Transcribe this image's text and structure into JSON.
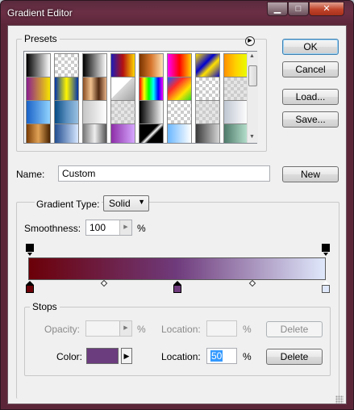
{
  "window": {
    "title": "Gradient Editor"
  },
  "presets": {
    "label": "Presets",
    "menu_icon": "circle-arrow-right-icon",
    "swatches": [
      "linear-gradient(90deg,#000,#fff)",
      "checker-white",
      "linear-gradient(90deg,#000,#fff)",
      "linear-gradient(90deg,#1c1cb8,#b41010,#ffd800)",
      "linear-gradient(90deg,#7a3500,#d8772e,#fde4b6)",
      "linear-gradient(90deg,#ff00ff,#ff0000,#ffd200)",
      "linear-gradient(135deg,#ffe100,#0000d0 40%,#ffe100 60%,#0000d0)",
      "linear-gradient(90deg,#ff9000,#ffd200,#e8ff00)",
      "linear-gradient(90deg,#8b1d8e,#f7e400)",
      "linear-gradient(90deg,#0033aa,#fff600,#0033aa)",
      "linear-gradient(90deg,#8a4d23,#f0c18f,#4f2810,#e9b489)",
      "linear-gradient(135deg,#ffffff 45%,#d8d8d8 45%,#a0a0a0)",
      "linear-gradient(90deg,#f00,#ff0,#0f0,#0ff,#00f,#f0f)",
      "linear-gradient(135deg,#1d59ff,#ff2a2a,#ffe300,#29d829)",
      "checker-white",
      "checker-gray",
      "linear-gradient(90deg,#1a62c7,#91d3ff)",
      "linear-gradient(90deg,#064a83,#5a8fbf,#9bc1e2)",
      "linear-gradient(90deg,#c6c6c6,#ffffff)",
      "checker-gray",
      "linear-gradient(90deg,#000,#ffffff)",
      "checker-white",
      "checker-gray",
      "linear-gradient(90deg,#bfc6d1,#ffffff)",
      "linear-gradient(90deg,#7a3c05,#e0a255,#4a2300)",
      "linear-gradient(90deg,#224e91,#d7e8ff)",
      "linear-gradient(90deg,#777,#eee,#555)",
      "linear-gradient(90deg,#8d2ea7,#d6a7ff)",
      "linear-gradient(135deg,#000 40%,#fff 48%,#000 56%)",
      "linear-gradient(90deg,#6ab7ff,#fff)",
      "linear-gradient(90deg,#3a3a3a,#d5d5d5)",
      "linear-gradient(90deg,#4e7a6a,#b7e1ce)"
    ]
  },
  "buttons": {
    "ok": "OK",
    "cancel": "Cancel",
    "load": "Load...",
    "save": "Save...",
    "new": "New",
    "delete_opacity": "Delete",
    "delete_color": "Delete"
  },
  "name": {
    "label": "Name:",
    "value": "Custom"
  },
  "gradient_type": {
    "label": "Gradient Type:",
    "value": "Solid"
  },
  "smoothness": {
    "label": "Smoothness:",
    "value": "100",
    "unit": "%"
  },
  "gradient": {
    "colors": [
      "#6b0008",
      "#6f3b7c",
      "#dfe8fb"
    ],
    "midpoints": [
      "",
      ""
    ]
  },
  "stops": {
    "label": "Stops",
    "opacity_label": "Opacity:",
    "opacity_unit": "%",
    "opacity_location_label": "Location:",
    "opacity_location_unit": "%",
    "color_label": "Color:",
    "color_value": "#6b3c7e",
    "color_location_label": "Location:",
    "color_location_value": "50",
    "color_location_unit": "%"
  }
}
